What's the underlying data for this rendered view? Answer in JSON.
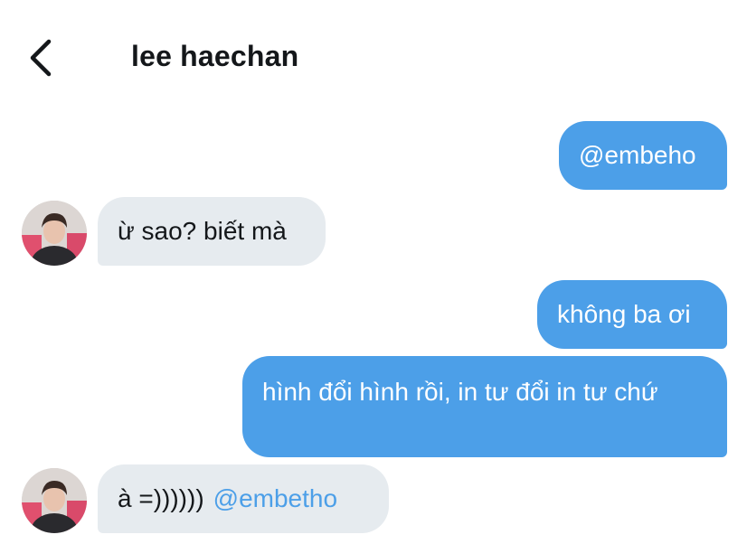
{
  "header": {
    "title": "lee haechan",
    "back_icon": "chevron-left-icon"
  },
  "colors": {
    "outgoing_bubble": "#4c9fe8",
    "incoming_bubble": "#e6ebef",
    "mention": "#4c9fe8"
  },
  "messages": [
    {
      "direction": "outgoing",
      "text": "@embeho"
    },
    {
      "direction": "incoming",
      "text": "ừ sao? biết mà"
    },
    {
      "direction": "outgoing",
      "text": "không ba ơi"
    },
    {
      "direction": "outgoing",
      "text": "hình đổi hình rồi, in tư đổi in tư chứ"
    },
    {
      "direction": "incoming",
      "text": "à =))))))",
      "mention": "@embetho"
    }
  ]
}
